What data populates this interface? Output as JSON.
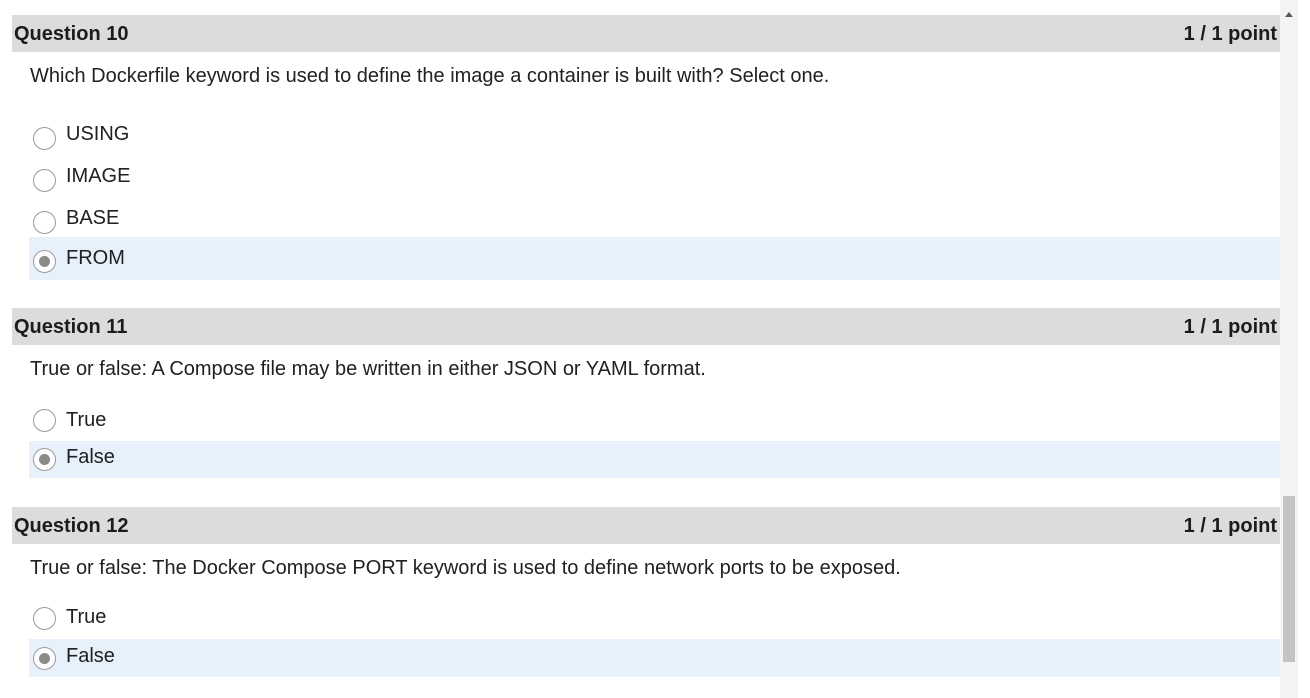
{
  "questions": [
    {
      "title": "Question 10",
      "score": "1 / 1 point",
      "text": "Which Dockerfile keyword is used to define the image a container is built with? Select one.",
      "options": [
        {
          "label": "USING",
          "selected": false
        },
        {
          "label": "IMAGE",
          "selected": false
        },
        {
          "label": "BASE",
          "selected": false
        },
        {
          "label": "FROM",
          "selected": true
        }
      ]
    },
    {
      "title": "Question 11",
      "score": "1 / 1 point",
      "text": "True or false: A Compose file may be written in either JSON or YAML format.",
      "options": [
        {
          "label": "True",
          "selected": false
        },
        {
          "label": "False",
          "selected": true
        }
      ]
    },
    {
      "title": "Question 12",
      "score": "1 / 1 point",
      "text": "True or false: The Docker Compose PORT keyword is used to define network ports to be exposed.",
      "options": [
        {
          "label": "True",
          "selected": false
        },
        {
          "label": "False",
          "selected": true
        }
      ]
    }
  ],
  "scrollbar": {
    "up_icon": "chevron-up-icon"
  },
  "colors": {
    "header_bg": "#dcdcdc",
    "selected_bg": "#e7f1fb",
    "radio_dot": "#8a8a8a"
  }
}
